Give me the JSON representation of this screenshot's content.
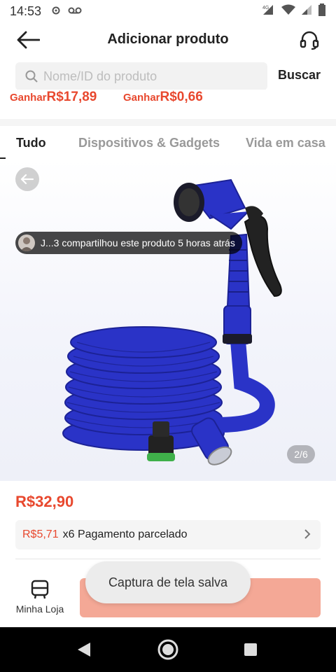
{
  "status_bar": {
    "time": "14:53",
    "network_label": "4G"
  },
  "header": {
    "title": "Adicionar produto"
  },
  "search": {
    "placeholder": "Nome/ID do produto",
    "value": "",
    "button_label": "Buscar"
  },
  "earn_strip": [
    {
      "prefix": "Ganhar",
      "amount": "R$17,89"
    },
    {
      "prefix": "Ganhar",
      "amount": "R$0,66"
    }
  ],
  "tabs": [
    {
      "label": "Tudo",
      "active": true
    },
    {
      "label": "Dispositivos & Gadgets",
      "active": false
    },
    {
      "label": "Vida em casa",
      "active": false
    }
  ],
  "product": {
    "share_text": "J...3 compartilhou este produto 5 horas atrás",
    "image_page": "2/6",
    "price": "R$32,90",
    "installment_price": "R$5,71",
    "installment_text": "x6 Pagamento parcelado"
  },
  "bottom": {
    "store_label": "Minha Loja"
  },
  "toast": {
    "text": "Captura de tela salva"
  },
  "colors": {
    "accent": "#e8482e",
    "add_button": "#f4a896",
    "hose_blue": "#2a33c7"
  }
}
